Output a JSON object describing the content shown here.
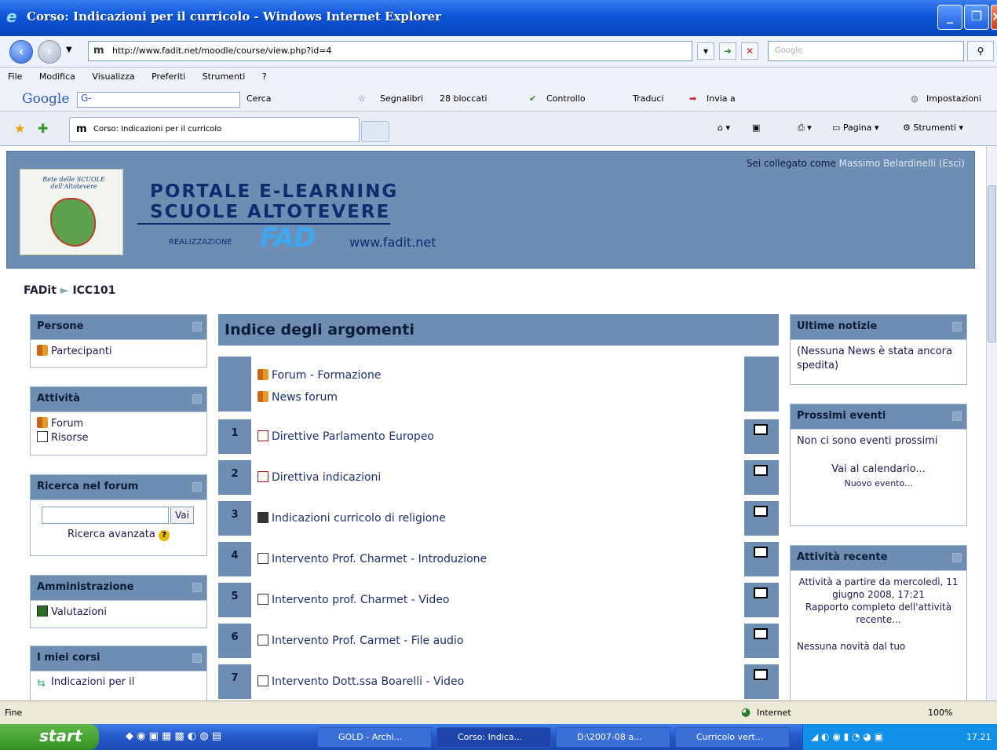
{
  "window": {
    "title": "Corso: Indicazioni per il curricolo - Windows Internet Explorer"
  },
  "address": {
    "url": "http://www.fadit.net/moodle/course/view.php?id=4",
    "search_placeholder": "Google"
  },
  "menubar": [
    "File",
    "Modifica",
    "Visualizza",
    "Preferiti",
    "Strumenti",
    "?"
  ],
  "google_toolbar": {
    "logo": "Google",
    "box": "G-",
    "cerca": "Cerca",
    "segnalibri": "Segnalibri",
    "bloccati": "28 bloccati",
    "controllo": "Controllo",
    "traduci": "Traduci",
    "invia": "Invia a",
    "impostazioni": "Impostazioni"
  },
  "tab": {
    "title": "Corso: Indicazioni per il curricolo"
  },
  "commandbar": {
    "pagina": "Pagina",
    "strumenti": "Strumenti"
  },
  "header": {
    "logo_text": "Rete delle SCUOLE dell'Altotevere",
    "title1": "PORTALE E-LEARNING",
    "title2": "SCUOLE ALTOTEVERE",
    "realizzazione": "REALIZZAZIONE",
    "fad": "FAD",
    "site": "www.fadit.net",
    "login_prefix": "Sei collegato come",
    "user": "Massimo Belardinelli",
    "logout": "(Esci)"
  },
  "breadcrumb": {
    "home": "FADit",
    "sep": "►",
    "course": "ICC101"
  },
  "left": {
    "persone": {
      "title": "Persone",
      "items": [
        "Partecipanti"
      ]
    },
    "attivita": {
      "title": "Attività",
      "items": [
        "Forum",
        "Risorse"
      ]
    },
    "ricerca": {
      "title": "Ricerca nel forum",
      "button": "Vai",
      "advanced": "Ricerca avanzata"
    },
    "amministrazione": {
      "title": "Amministrazione",
      "items": [
        "Valutazioni"
      ]
    },
    "corsi": {
      "title": "I miei corsi",
      "items": [
        "Indicazioni per il"
      ]
    }
  },
  "sections": {
    "title": "Indice degli argomenti",
    "top": [
      "Forum - Formazione",
      "News forum"
    ],
    "rows": [
      {
        "num": "1",
        "label": "Direttive Parlamento Europeo"
      },
      {
        "num": "2",
        "label": "Direttiva indicazioni"
      },
      {
        "num": "3",
        "label": "Indicazioni curricolo di religione"
      },
      {
        "num": "4",
        "label": "Intervento Prof. Charmet - Introduzione"
      },
      {
        "num": "5",
        "label": "Intervento prof. Charmet - Video"
      },
      {
        "num": "6",
        "label": "Intervento Prof. Carmet - File audio"
      },
      {
        "num": "7",
        "label": "Intervento Dott.ssa Boarelli - Video"
      }
    ]
  },
  "right": {
    "notizie": {
      "title": "Ultime notizie",
      "text": "(Nessuna News è stata ancora spedita)"
    },
    "eventi": {
      "title": "Prossimi eventi",
      "text": "Non ci sono eventi prossimi",
      "link1": "Vai al calendario...",
      "link2": "Nuovo evento..."
    },
    "recente": {
      "title": "Attività recente",
      "text1": "Attività a partire da mercoledì, 11 giugno 2008, 17:21",
      "link": "Rapporto completo dell'attività recente...",
      "text2": "Nessuna novità dal tuo"
    }
  },
  "status": {
    "left": "Fine",
    "zone": "Internet",
    "zoom": "100%"
  },
  "taskbar": {
    "start": "start",
    "buttons": [
      "GOLD - Archi...",
      "Corso: Indica...",
      "D:\\2007-08 a...",
      "Curricolo vert..."
    ],
    "clock": "17.21"
  }
}
